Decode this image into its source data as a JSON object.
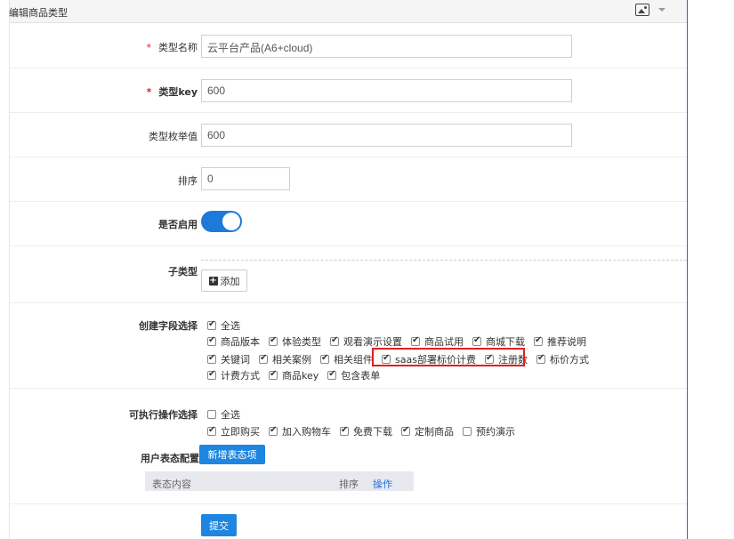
{
  "panel": {
    "title": "编辑商品类型"
  },
  "form": {
    "type_name": {
      "label": "类型名称",
      "required": "*",
      "value": "云平台产品(A6+cloud)"
    },
    "type_key": {
      "label": "类型key",
      "required": "*",
      "value": "600"
    },
    "enum_value": {
      "label": "类型枚举值",
      "value": "600"
    },
    "sort": {
      "label": "排序",
      "value": "0"
    },
    "enabled": {
      "label": "是否启用",
      "state": "on"
    },
    "subtype": {
      "label": "子类型",
      "add_label": "添加"
    },
    "create_fields": {
      "label": "创建字段选择",
      "select_all": {
        "label": "全选",
        "checked": true
      },
      "rows": [
        [
          {
            "label": "商品版本",
            "checked": true
          },
          {
            "label": "体验类型",
            "checked": true
          },
          {
            "label": "观看演示设置",
            "checked": true
          },
          {
            "label": "商品试用",
            "checked": true
          },
          {
            "label": "商城下载",
            "checked": true
          },
          {
            "label": "推荐说明",
            "checked": true
          }
        ],
        [
          {
            "label": "关键词",
            "checked": true
          },
          {
            "label": "相关案例",
            "checked": true
          },
          {
            "label": "相关组件",
            "checked": true
          },
          {
            "label": "saas部署标价计费",
            "checked": true
          },
          {
            "label": "注册数",
            "checked": true
          },
          {
            "label": "标价方式",
            "checked": true
          }
        ],
        [
          {
            "label": "计费方式",
            "checked": true
          },
          {
            "label": "商品key",
            "checked": true
          },
          {
            "label": "包含表单",
            "checked": true
          }
        ]
      ]
    },
    "actions": {
      "label": "可执行操作选择",
      "select_all": {
        "label": "全选",
        "checked": false
      },
      "items": [
        {
          "label": "立即购买",
          "checked": true
        },
        {
          "label": "加入购物车",
          "checked": true
        },
        {
          "label": "免费下载",
          "checked": true
        },
        {
          "label": "定制商品",
          "checked": true
        },
        {
          "label": "预约演示",
          "checked": false
        }
      ]
    },
    "user_status": {
      "label": "用户表态配置",
      "add_button": "新增表态项",
      "columns": {
        "content": "表态内容",
        "sort": "排序",
        "op": "操作"
      }
    },
    "submit_label": "提交"
  },
  "colors": {
    "primary": "#1e86e0",
    "highlight": "#e02020"
  }
}
